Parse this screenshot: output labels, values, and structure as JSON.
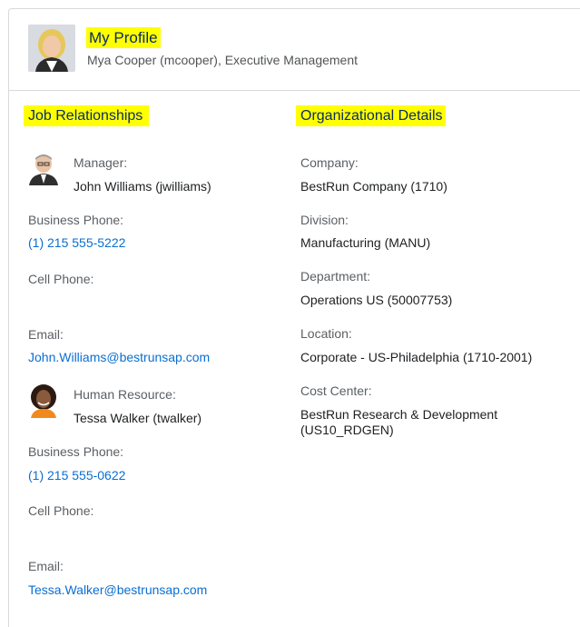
{
  "header": {
    "title": "My Profile",
    "subtitle": "Mya Cooper (mcooper), Executive Management"
  },
  "job_relationships": {
    "heading": "Job Relationships",
    "manager": {
      "role_label": "Manager:",
      "name": "John Williams (jwilliams)",
      "business_phone_label": "Business Phone:",
      "business_phone": "(1) 215 555-5222",
      "cell_phone_label": "Cell Phone:",
      "email_label": "Email:",
      "email": "John.Williams@bestrunsap.com"
    },
    "hr": {
      "role_label": "Human Resource:",
      "name": "Tessa Walker (twalker)",
      "business_phone_label": "Business Phone:",
      "business_phone": "(1) 215 555-0622",
      "cell_phone_label": "Cell Phone:",
      "email_label": "Email:",
      "email": "Tessa.Walker@bestrunsap.com"
    }
  },
  "org_details": {
    "heading": "Organizational Details",
    "company_label": "Company:",
    "company": "BestRun Company (1710)",
    "division_label": "Division:",
    "division": "Manufacturing (MANU)",
    "department_label": "Department:",
    "department": "Operations US (50007753)",
    "location_label": "Location:",
    "location": "Corporate - US-Philadelphia (1710-2001)",
    "cost_center_label": "Cost Center:",
    "cost_center_line1": "BestRun Research & Development",
    "cost_center_line2": "(US10_RDGEN)"
  },
  "colors": {
    "highlight": "#ffff00",
    "heading_text": "#0a2d66",
    "link": "#0a6ed1"
  }
}
